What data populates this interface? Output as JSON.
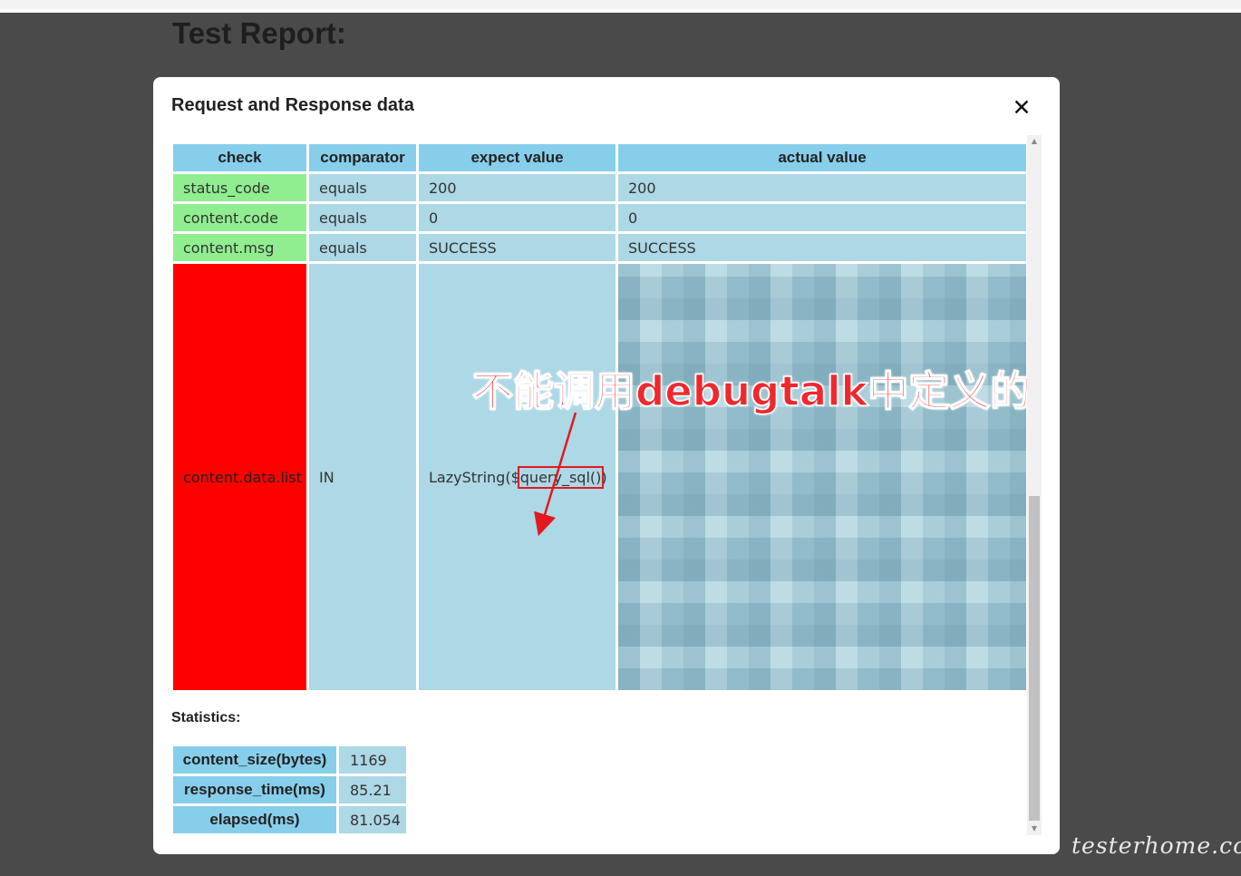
{
  "page": {
    "heading": "Test Report:"
  },
  "modal": {
    "title": "Request and Response data",
    "close_glyph": "✕",
    "checks_table": {
      "headers": [
        "check",
        "comparator",
        "expect value",
        "actual value"
      ],
      "rows": [
        {
          "check": "status_code",
          "comparator": "equals",
          "expect": "200",
          "actual": "200",
          "status": "pass"
        },
        {
          "check": "content.code",
          "comparator": "equals",
          "expect": "0",
          "actual": "0",
          "status": "pass"
        },
        {
          "check": "content.msg",
          "comparator": "equals",
          "expect": "SUCCESS",
          "actual": "SUCCESS",
          "status": "pass"
        },
        {
          "check": "content.data.list",
          "comparator": "IN",
          "expect_prefix": "LazyString($",
          "expect_highlight": "query_sql()",
          "expect_suffix": ")",
          "actual": "",
          "status": "fail"
        }
      ]
    },
    "annotation": "不能调用debugtalk中定义的方法",
    "statistics": {
      "title": "Statistics:",
      "rows": [
        {
          "label": "content_size(bytes)",
          "value": "1169"
        },
        {
          "label": "response_time(ms)",
          "value": "85.21"
        },
        {
          "label": "elapsed(ms)",
          "value": "81.054"
        }
      ]
    }
  },
  "watermark": "testerhome.com",
  "colors": {
    "pass": "#90ee90",
    "fail": "#ff0000",
    "header": "#87ceeb",
    "cell": "#add8e6",
    "annotation": "#f0282d"
  }
}
